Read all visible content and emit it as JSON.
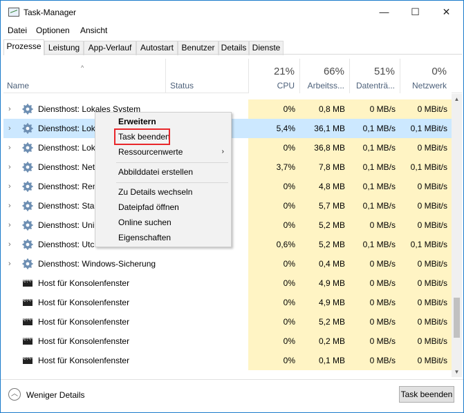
{
  "window": {
    "title": "Task-Manager",
    "minimize": "—",
    "maximize": "☐",
    "close": "✕"
  },
  "menu": [
    "Datei",
    "Optionen",
    "Ansicht"
  ],
  "tabs": [
    "Prozesse",
    "Leistung",
    "App-Verlauf",
    "Autostart",
    "Benutzer",
    "Details",
    "Dienste"
  ],
  "active_tab": "Prozesse",
  "columns": {
    "name": "Name",
    "status": "Status",
    "cpu": {
      "pct": "21%",
      "label": "CPU"
    },
    "mem": {
      "pct": "66%",
      "label": "Arbeitss..."
    },
    "disk": {
      "pct": "51%",
      "label": "Datenträ..."
    },
    "net": {
      "pct": "0%",
      "label": "Netzwerk"
    }
  },
  "rows": [
    {
      "name": "Diensthost: Lokales System",
      "icon": "gear-icon",
      "expand": true,
      "cpu": "0%",
      "mem": "0,8 MB",
      "disk": "0 MB/s",
      "net": "0 MBit/s",
      "selected": false
    },
    {
      "name": "Diensthost: Lok",
      "icon": "gear-icon",
      "expand": true,
      "cpu": "5,4%",
      "mem": "36,1 MB",
      "disk": "0,1 MB/s",
      "net": "0,1 MBit/s",
      "selected": true
    },
    {
      "name": "Diensthost: Lok",
      "icon": "gear-icon",
      "expand": true,
      "cpu": "0%",
      "mem": "36,8 MB",
      "disk": "0,1 MB/s",
      "net": "0 MBit/s",
      "selected": false
    },
    {
      "name": "Diensthost: Net",
      "icon": "gear-icon",
      "expand": true,
      "cpu": "3,7%",
      "mem": "7,8 MB",
      "disk": "0,1 MB/s",
      "net": "0,1 MBit/s",
      "selected": false
    },
    {
      "name": "Diensthost: Ren",
      "icon": "gear-icon",
      "expand": true,
      "cpu": "0%",
      "mem": "4,8 MB",
      "disk": "0,1 MB/s",
      "net": "0 MBit/s",
      "selected": false
    },
    {
      "name": "Diensthost: Star",
      "icon": "gear-icon",
      "expand": true,
      "cpu": "0%",
      "mem": "5,7 MB",
      "disk": "0,1 MB/s",
      "net": "0 MBit/s",
      "selected": false
    },
    {
      "name": "Diensthost: Uni",
      "icon": "gear-icon",
      "expand": true,
      "cpu": "0%",
      "mem": "5,2 MB",
      "disk": "0 MB/s",
      "net": "0 MBit/s",
      "selected": false
    },
    {
      "name": "Diensthost: Utc",
      "icon": "gear-icon",
      "expand": true,
      "cpu": "0,6%",
      "mem": "5,2 MB",
      "disk": "0,1 MB/s",
      "net": "0,1 MBit/s",
      "selected": false
    },
    {
      "name": "Diensthost: Windows-Sicherung",
      "icon": "gear-icon",
      "expand": true,
      "cpu": "0%",
      "mem": "0,4 MB",
      "disk": "0 MB/s",
      "net": "0 MBit/s",
      "selected": false
    },
    {
      "name": "Host für Konsolenfenster",
      "icon": "console-icon",
      "expand": false,
      "cpu": "0%",
      "mem": "4,9 MB",
      "disk": "0 MB/s",
      "net": "0 MBit/s",
      "selected": false
    },
    {
      "name": "Host für Konsolenfenster",
      "icon": "console-icon",
      "expand": false,
      "cpu": "0%",
      "mem": "4,9 MB",
      "disk": "0 MB/s",
      "net": "0 MBit/s",
      "selected": false
    },
    {
      "name": "Host für Konsolenfenster",
      "icon": "console-icon",
      "expand": false,
      "cpu": "0%",
      "mem": "5,2 MB",
      "disk": "0 MB/s",
      "net": "0 MBit/s",
      "selected": false
    },
    {
      "name": "Host für Konsolenfenster",
      "icon": "console-icon",
      "expand": false,
      "cpu": "0%",
      "mem": "0,2 MB",
      "disk": "0 MB/s",
      "net": "0 MBit/s",
      "selected": false
    },
    {
      "name": "Host für Konsolenfenster",
      "icon": "console-icon",
      "expand": false,
      "cpu": "0%",
      "mem": "0,1 MB",
      "disk": "0 MB/s",
      "net": "0 MBit/s",
      "selected": false
    }
  ],
  "context_menu": {
    "items": [
      "Erweitern",
      "Task beenden",
      "Ressourcenwerte",
      "Abbilddatei erstellen",
      "Zu Details wechseln",
      "Dateipfad öffnen",
      "Online suchen",
      "Eigenschaften"
    ],
    "submenu_arrow": "›"
  },
  "footer": {
    "fewer_details": "Weniger Details",
    "end_task": "Task beenden",
    "fewer_icon": "chevron-up-icon"
  },
  "colors": {
    "metric_bg": "#fff4c4",
    "selected_bg": "#cce8ff",
    "highlight_border": "#e8262a",
    "header_text": "#4c607a"
  }
}
